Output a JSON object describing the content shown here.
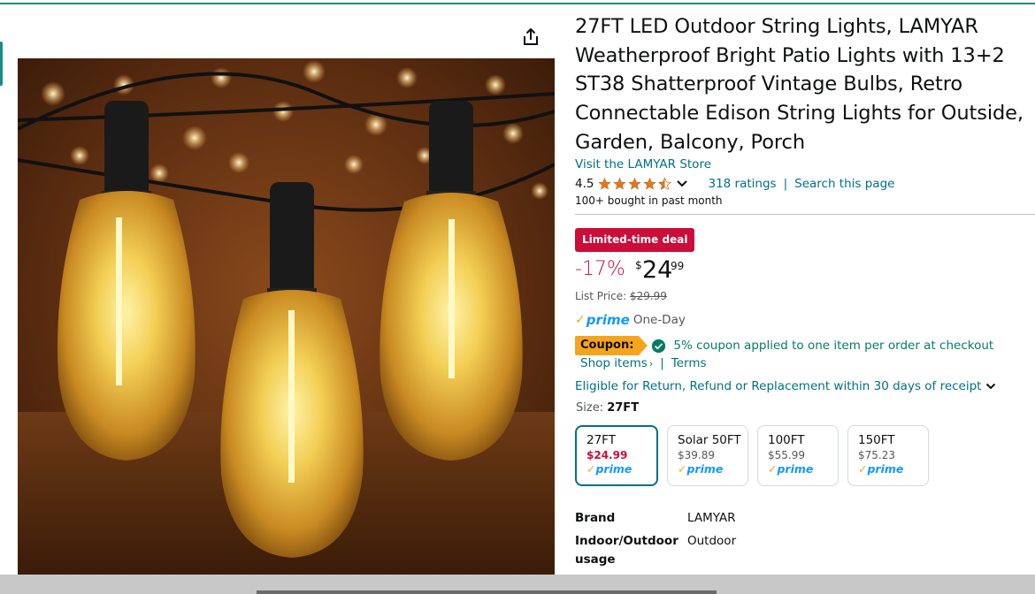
{
  "product": {
    "title": "27FT LED Outdoor String Lights, LAMYAR Weatherproof Bright Patio Lights with 13+2 ST38 Shatterproof Vintage Bulbs, Retro Connectable Edison String Lights for Outside, Garden, Balcony, Porch",
    "store_link": "Visit the LAMYAR Store",
    "rating": "4.5",
    "stars_filled": 4.5,
    "ratings_count": "318 ratings",
    "search_page": "Search this page",
    "separator": "|",
    "bought": "100+ bought in past month"
  },
  "deal": {
    "badge": "Limited-time deal",
    "discount": "-17%",
    "currency": "$",
    "whole": "24",
    "fraction": "99",
    "list_price_label": "List Price:",
    "list_price": "$29.99"
  },
  "prime": {
    "check": "✓",
    "word": "prime",
    "delivery": "One-Day"
  },
  "coupon": {
    "label": "Coupon:",
    "text": "5% coupon applied to one item per order at checkout",
    "shop_items": "Shop items",
    "shop_chevron": "›",
    "terms": "Terms",
    "separator": "|"
  },
  "returns": {
    "text": "Eligible for Return, Refund or Replacement within 30 days of receipt"
  },
  "size": {
    "label": "Size:",
    "value": "27FT",
    "options": [
      {
        "name": "27FT",
        "price": "$24.99",
        "prime": "prime",
        "check": "✓"
      },
      {
        "name": "Solar 50FT",
        "price": "$39.89",
        "prime": "prime",
        "check": "✓"
      },
      {
        "name": "100FT",
        "price": "$55.99",
        "prime": "prime",
        "check": "✓"
      },
      {
        "name": "150FT",
        "price": "$75.23",
        "prime": "prime",
        "check": "✓"
      }
    ]
  },
  "specs": [
    {
      "key": "Brand",
      "value": "LAMYAR"
    },
    {
      "key": "Indoor/Outdoor usage",
      "value": "Outdoor"
    }
  ],
  "colors": {
    "link": "#007185",
    "deal_red": "#cc0c39",
    "prime_blue": "#1399ff",
    "prime_orange": "#f7a41d",
    "coupon_green": "#067d62",
    "accent_teal": "#1a8a84"
  },
  "icons": {
    "share": "share-icon",
    "star": "star-icon",
    "chevron": "chevron-down-icon",
    "check_circle": "check-circle-icon"
  }
}
